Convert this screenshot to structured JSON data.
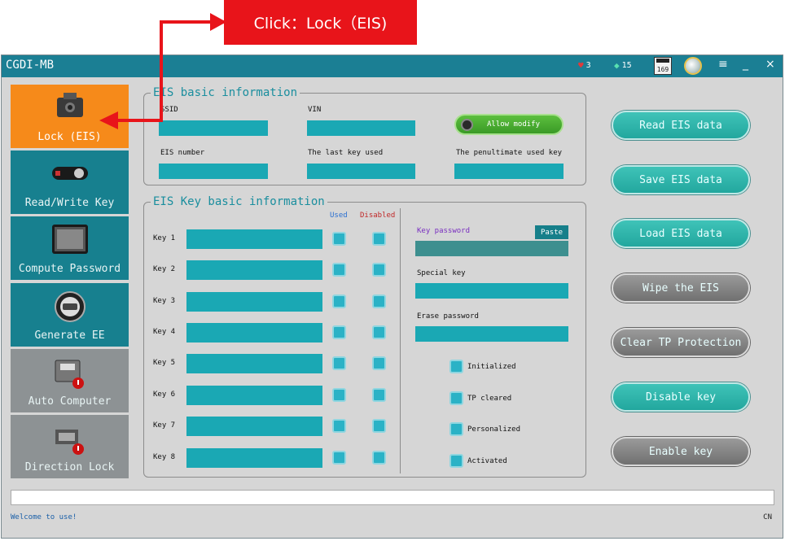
{
  "annotation": {
    "callout_text": "Click：Lock（EIS)"
  },
  "titlebar": {
    "title": "CGDI-MB",
    "hearts": "3",
    "diamonds": "15",
    "calendar_day": "169",
    "menu_icon": "menu-icon",
    "minimize": "_",
    "close": "×"
  },
  "nav": {
    "items": [
      {
        "label": "Lock (EIS)",
        "icon": "lock-chip-icon"
      },
      {
        "label": "Read/Write Key",
        "icon": "car-key-icon"
      },
      {
        "label": "Compute Password",
        "icon": "keypad-icon"
      },
      {
        "label": "Generate EE",
        "icon": "dashboard-gauge-icon"
      },
      {
        "label": "Auto Computer",
        "icon": "ecu-icon"
      },
      {
        "label": "Direction Lock",
        "icon": "steering-lock-icon"
      }
    ]
  },
  "eis_basic": {
    "title": "EIS basic information",
    "ssid_label": "SSID",
    "vin_label": "VIN",
    "allow_modify": "Allow modify",
    "eis_number_label": "EIS number",
    "last_key_label": "The last key used",
    "penultimate_key_label": "The penultimate used key"
  },
  "eis_key": {
    "title": "EIS Key basic information",
    "used_header": "Used",
    "disabled_header": "Disabled",
    "keys": [
      "Key 1",
      "Key 2",
      "Key 3",
      "Key 4",
      "Key 5",
      "Key 6",
      "Key 7",
      "Key 8"
    ],
    "key_password_label": "Key password",
    "paste_button": "Paste",
    "special_key_label": "Special key",
    "erase_password_label": "Erase password",
    "flags": [
      "Initialized",
      "TP cleared",
      "Personalized",
      "Activated"
    ]
  },
  "actions": {
    "buttons": [
      {
        "label": "Read  EIS data",
        "style": "teal"
      },
      {
        "label": "Save EIS data",
        "style": "teal"
      },
      {
        "label": "Load EIS data",
        "style": "teal"
      },
      {
        "label": "Wipe the EIS",
        "style": "gray"
      },
      {
        "label": "Clear TP Protection",
        "style": "gray"
      },
      {
        "label": "Disable key",
        "style": "teal"
      },
      {
        "label": "Enable key",
        "style": "gray"
      }
    ]
  },
  "status": {
    "message": "Welcome to use!",
    "language": "CN"
  },
  "colors": {
    "accent": "#17808f",
    "active": "#f68a1a",
    "annotation": "#e8141a"
  }
}
